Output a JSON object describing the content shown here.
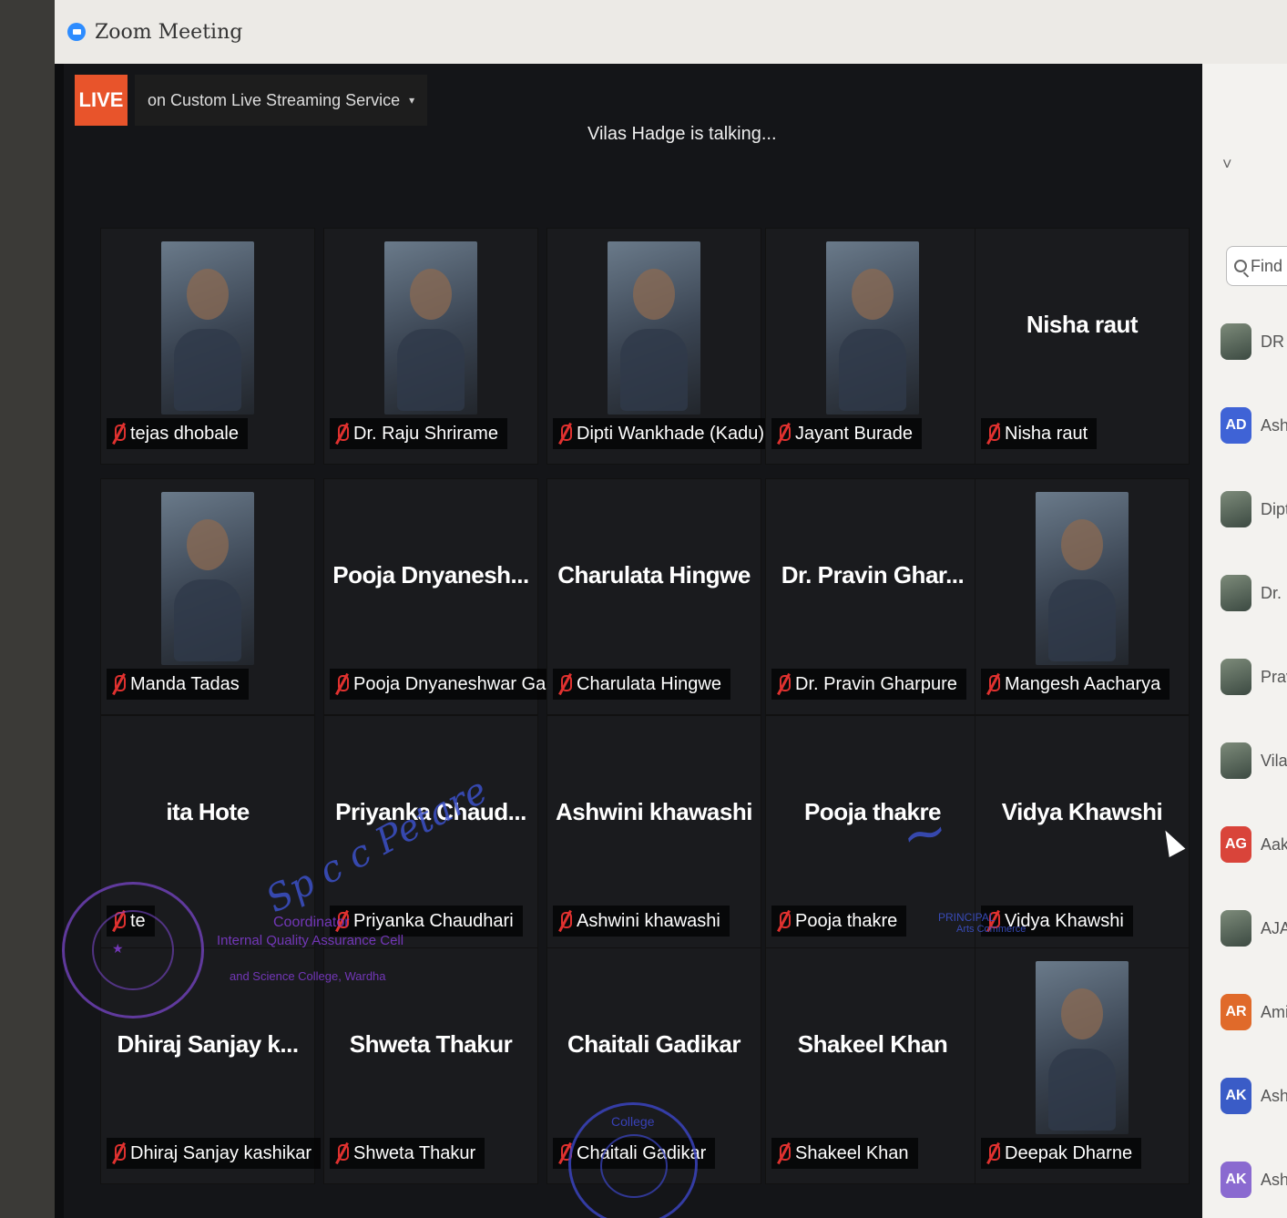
{
  "window": {
    "title": "Zoom Meeting"
  },
  "live": {
    "badge": "LIVE",
    "service": "on Custom Live Streaming Service",
    "caret": "▾"
  },
  "talking": "Vilas Hadge is talking...",
  "tiles": [
    {
      "center_name": "",
      "tag": "tejas dhobale",
      "video": true
    },
    {
      "center_name": "",
      "tag": "Dr. Raju Shrirame",
      "video": true
    },
    {
      "center_name": "",
      "tag": "Dipti Wankhade (Kadu)",
      "video": true
    },
    {
      "center_name": "",
      "tag": "Jayant Burade",
      "video": true
    },
    {
      "center_name": "Nisha raut",
      "tag": "Nisha raut",
      "video": false
    },
    {
      "center_name": "",
      "tag": "Manda Tadas",
      "video": true
    },
    {
      "center_name": "Pooja Dnyanesh...",
      "tag": "Pooja Dnyaneshwar Gadge",
      "video": false
    },
    {
      "center_name": "Charulata Hingwe",
      "tag": "Charulata Hingwe",
      "video": false
    },
    {
      "center_name": "Dr. Pravin Ghar...",
      "tag": "Dr. Pravin Gharpure",
      "video": false
    },
    {
      "center_name": "",
      "tag": "Mangesh Aacharya",
      "video": true
    },
    {
      "center_name": "ita Hote",
      "tag": "te",
      "video": false
    },
    {
      "center_name": "Priyanka Chaud...",
      "tag": "Priyanka Chaudhari",
      "video": false
    },
    {
      "center_name": "Ashwini khawashi",
      "tag": "Ashwini khawashi",
      "video": false
    },
    {
      "center_name": "Pooja thakre",
      "tag": "Pooja thakre",
      "video": false
    },
    {
      "center_name": "Vidya Khawshi",
      "tag": "Vidya Khawshi",
      "video": false
    },
    {
      "center_name": "Dhiraj Sanjay k...",
      "tag": "Dhiraj Sanjay kashikar",
      "video": false
    },
    {
      "center_name": "Shweta Thakur",
      "tag": "Shweta Thakur",
      "video": false
    },
    {
      "center_name": "Chaitali Gadikar",
      "tag": "Chaitali Gadikar",
      "video": false
    },
    {
      "center_name": "Shakeel Khan",
      "tag": "Shakeel Khan",
      "video": false
    },
    {
      "center_name": "",
      "tag": "Deepak Dharne",
      "video": true
    }
  ],
  "panel": {
    "chevron": "˅",
    "find_placeholder": "Find",
    "participants": [
      {
        "initials": "",
        "name": "DR",
        "color": ""
      },
      {
        "initials": "AD",
        "name": "Ash",
        "color": "#3f63d6"
      },
      {
        "initials": "",
        "name": "Dipt",
        "color": ""
      },
      {
        "initials": "",
        "name": "Dr. I",
        "color": ""
      },
      {
        "initials": "",
        "name": "Prav",
        "color": ""
      },
      {
        "initials": "",
        "name": "Vilas",
        "color": ""
      },
      {
        "initials": "AG",
        "name": "Aakar",
        "color": "#d9443a"
      },
      {
        "initials": "",
        "name": "AJAY",
        "color": ""
      },
      {
        "initials": "AR",
        "name": "Amit R",
        "color": "#e06a2a"
      },
      {
        "initials": "AK",
        "name": "Ashles",
        "color": "#3a5cc7"
      },
      {
        "initials": "AK",
        "name": "Ashwin",
        "color": "#8a6ad0"
      }
    ]
  },
  "stamps": {
    "coordinator_text": "Coordinator",
    "iqac_text": "Internal Quality Assurance Cell",
    "college_text": "and Science College, Wardha",
    "principal_text": "PRINCIPAL",
    "commerce_text": "Arts Commerce",
    "round_seal_text": "College"
  }
}
